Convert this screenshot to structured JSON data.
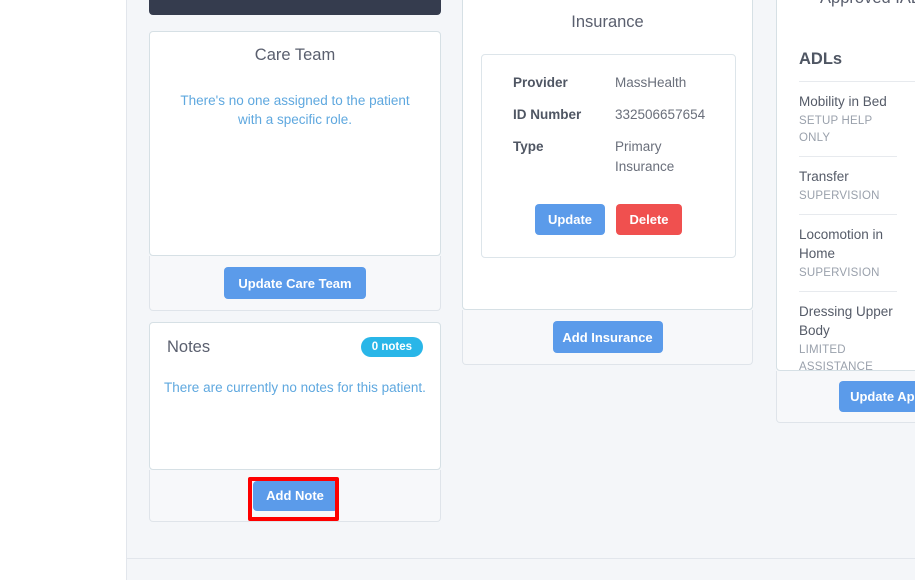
{
  "top_partial_card": {
    "button_label": ""
  },
  "care_team": {
    "title": "Care Team",
    "empty_message": "There's no one assigned to the patient with a specific role.",
    "update_button": "Update Care Team"
  },
  "notes": {
    "title": "Notes",
    "badge": "0 notes",
    "empty_message": "There are currently no notes for this patient.",
    "add_button": "Add Note",
    "highlight_color": "#fe0000"
  },
  "insurance": {
    "title": "Insurance",
    "fields": [
      {
        "key": "Provider",
        "value": "MassHealth"
      },
      {
        "key": "ID Number",
        "value": "332506657654"
      },
      {
        "key": "Type",
        "value": "Primary Insurance"
      }
    ],
    "update_button": "Update",
    "delete_button": "Delete",
    "add_button": "Add Insurance"
  },
  "approved_panel": {
    "clipped_title": "Approved IADL",
    "adls_heading": "ADLs",
    "adl_items": [
      {
        "name": "Mobility in Bed",
        "level": "SETUP HELP ONLY"
      },
      {
        "name": "Transfer",
        "level": "SUPERVISION"
      },
      {
        "name": "Locomotion in Home",
        "level": "SUPERVISION"
      },
      {
        "name": "Dressing Upper Body",
        "level": "LIMITED ASSISTANCE"
      }
    ],
    "update_button": "Update Approved"
  },
  "theme": {
    "primary": "#5b9bea",
    "danger": "#f0504f",
    "badge": "#29b6e8",
    "dark": "#353c4e",
    "page_bg": "#f4f6f9"
  }
}
